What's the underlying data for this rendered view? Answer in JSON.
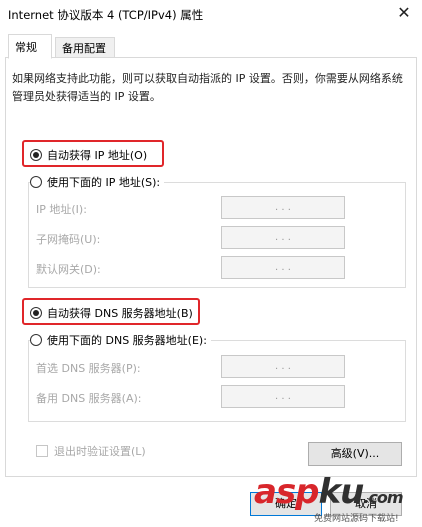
{
  "window": {
    "title": "Internet 协议版本 4 (TCP/IPv4) 属性",
    "close_glyph": "✕"
  },
  "tabs": [
    {
      "label": "常规",
      "active": true
    },
    {
      "label": "备用配置",
      "active": false
    }
  ],
  "description": "如果网络支持此功能，则可以获取自动指派的 IP 设置。否则，你需要从网络系统管理员处获得适当的 IP 设置。",
  "ip": {
    "auto_label": "自动获得 IP 地址(O)",
    "auto_selected": true,
    "manual_label": "使用下面的 IP 地址(S):",
    "manual_selected": false,
    "fields": [
      {
        "label": "IP 地址(I):",
        "value": ".     .     ."
      },
      {
        "label": "子网掩码(U):",
        "value": ".     .     ."
      },
      {
        "label": "默认网关(D):",
        "value": ".     .     ."
      }
    ]
  },
  "dns": {
    "auto_label": "自动获得 DNS 服务器地址(B)",
    "auto_selected": true,
    "manual_label": "使用下面的 DNS 服务器地址(E):",
    "manual_selected": false,
    "fields": [
      {
        "label": "首选 DNS 服务器(P):",
        "value": ".     .     ."
      },
      {
        "label": "备用 DNS 服务器(A):",
        "value": ".     .     ."
      }
    ]
  },
  "validate_on_exit": {
    "label": "退出时验证设置(L)",
    "checked": false,
    "enabled": false
  },
  "buttons": {
    "advanced": "高级(V)...",
    "ok": "确定",
    "cancel": "取消"
  },
  "highlight_color": "#e0262a",
  "watermark": {
    "logo_red": "asp",
    "logo_dark": "ku",
    "logo_suffix": ".com",
    "subtitle": "免费网站源码下载站!"
  }
}
